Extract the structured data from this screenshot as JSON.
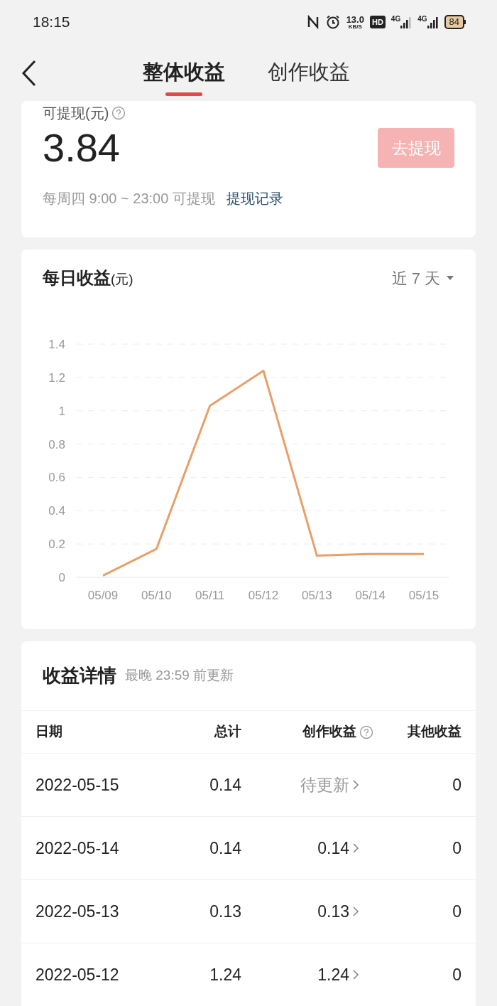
{
  "status_bar": {
    "time": "18:15",
    "speed": "13.0",
    "speed_unit": "KB/S",
    "hd": "HD",
    "networks": [
      "4G",
      "4G"
    ],
    "battery": "84"
  },
  "header": {
    "tabs": [
      {
        "label": "整体收益",
        "selected": true
      },
      {
        "label": "创作收益",
        "selected": false
      }
    ]
  },
  "balance_card": {
    "label": "可提现(元)",
    "amount": "3.84",
    "withdraw_button": {
      "label": "去提现",
      "disabled": true
    },
    "note": "每周四 9:00 ~ 23:00 可提现",
    "record_link": "提现记录"
  },
  "daily_card": {
    "title": "每日收益",
    "unit": "(元)",
    "range": "近 7 天",
    "chart_data": {
      "type": "line",
      "categories": [
        "05/09",
        "05/10",
        "05/11",
        "05/12",
        "05/13",
        "05/14",
        "05/15"
      ],
      "grid": true,
      "series": [
        {
          "color": "#e8a06a",
          "values": [
            0.01,
            0.17,
            1.03,
            1.24,
            0.13,
            0.14,
            0.14
          ]
        }
      ],
      "ylim": [
        0,
        1.4
      ],
      "yticks": [
        0,
        0.2,
        0.4,
        0.6,
        0.8,
        1,
        1.2,
        1.4
      ]
    }
  },
  "details_card": {
    "title": "收益详情",
    "subtitle": "最晚 23:59 前更新",
    "columns": [
      "日期",
      "总计",
      "创作收益",
      "其他收益"
    ],
    "rows": [
      {
        "date": "2022-05-15",
        "total": "0.14",
        "creation": "待更新",
        "kind": "pending",
        "other": "0"
      },
      {
        "date": "2022-05-14",
        "total": "0.14",
        "creation": "0.14",
        "kind": "value",
        "other": "0"
      },
      {
        "date": "2022-05-13",
        "total": "0.13",
        "creation": "0.13",
        "kind": "value",
        "other": "0"
      },
      {
        "date": "2022-05-12",
        "total": "1.24",
        "creation": "1.24",
        "kind": "value",
        "other": "0"
      }
    ]
  }
}
